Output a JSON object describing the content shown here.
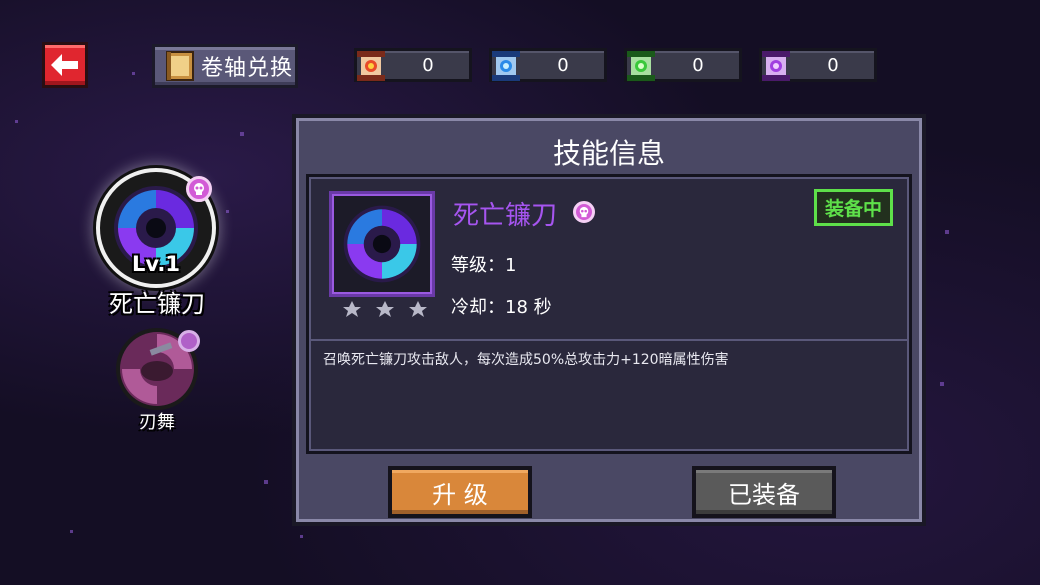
{
  "header": {
    "back_icon": "back-arrow-icon",
    "scroll_exchange_label": "卷轴兑换",
    "resources": [
      {
        "name": "red-scroll",
        "color": "#e84a2a",
        "value": "0"
      },
      {
        "name": "blue-scroll",
        "color": "#2a8ae8",
        "value": "0"
      },
      {
        "name": "green-scroll",
        "color": "#3ac83a",
        "value": "0"
      },
      {
        "name": "purple-scroll",
        "color": "#a040e0",
        "value": "0"
      }
    ]
  },
  "skill_list": [
    {
      "name": "死亡镰刀",
      "level": "Lv.1",
      "selected": true
    },
    {
      "name": "刃舞",
      "selected": false
    }
  ],
  "panel": {
    "title": "技能信息",
    "skill_name": "死亡镰刀",
    "status_badge": "装备中",
    "level_text": "等级：1",
    "cooldown_text": "冷却：18 秒",
    "description": "召唤死亡镰刀攻击敌人，每次造成50%总攻击力+120暗属性伤害",
    "upgrade_label": "升 级",
    "equip_label": "已装备"
  },
  "colors": {
    "accent_purple": "#a655f0",
    "equipped_green": "#5ee04a",
    "upgrade_orange": "#d9873a"
  }
}
